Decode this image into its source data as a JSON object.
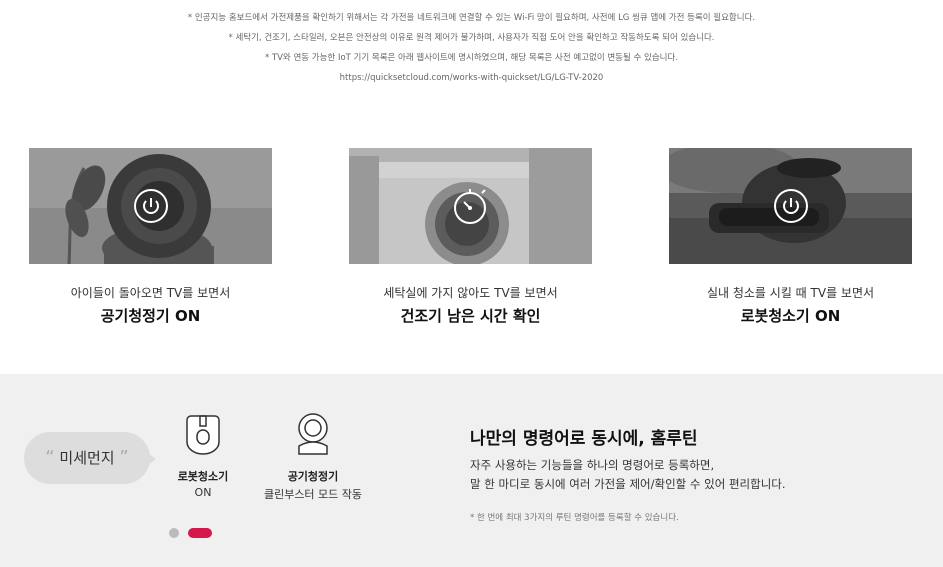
{
  "notes": [
    "* 인공지능 홈보드에서 가전제품을 확인하기 위해서는 각 가전을 네트워크에 연결할 수 있는 Wi-Fi 망이 필요하며, 사전에 LG 씽큐 앱에 가전 등록이 필요합니다.",
    "* 세탁기, 건조기, 스타일러, 오븐은 안전상의 이유로 원격 제어가 불가하며, 사용자가 직접 도어 안을 확인하고 작동하도록 되어 있습니다.",
    "* TV와 연동 가능한 IoT 기기 목록은 아래 웹사이트에 명시하였으며, 해당 목록은 사전 예고없이 변동될 수 있습니다.",
    "https://quicksetcloud.com/works-with-quickset/LG/LG-TV-2020"
  ],
  "cards": [
    {
      "sub": "아이들이 돌아오면 TV를 보면서",
      "title": "공기청정기 ON",
      "icon": "power-icon"
    },
    {
      "sub": "세탁실에 가지 않아도 TV를 보면서",
      "title": "건조기 남은 시간 확인",
      "icon": "timer-icon"
    },
    {
      "sub": "실내 청소를 시킬 때 TV를 보면서",
      "title": "로봇청소기 ON",
      "icon": "power-icon"
    }
  ],
  "routine": {
    "bubble": "미세먼지",
    "quote_open": "“",
    "quote_close": "”",
    "devices": [
      {
        "name": "로봇청소기",
        "state": "ON",
        "icon": "robot-vacuum-icon"
      },
      {
        "name": "공기청정기",
        "state": "클린부스터 모드 작동",
        "icon": "air-purifier-icon"
      }
    ],
    "title": "나만의 명령어로 동시에, 홈루틴",
    "desc1": "자주 사용하는 기능들을 하나의 명령어로 등록하면,",
    "desc2": "말 한 마디로 동시에 여러 가전을 제어/확인할 수 있어 편리합니다.",
    "note": "* 한 번에 최대 3가지의 루틴 명령어를 등록할 수 있습니다.",
    "pagination": {
      "active": 2,
      "total": 2
    },
    "colors": {
      "active_dot": "#d6174b",
      "inactive_dot": "#bbbbbb"
    }
  }
}
